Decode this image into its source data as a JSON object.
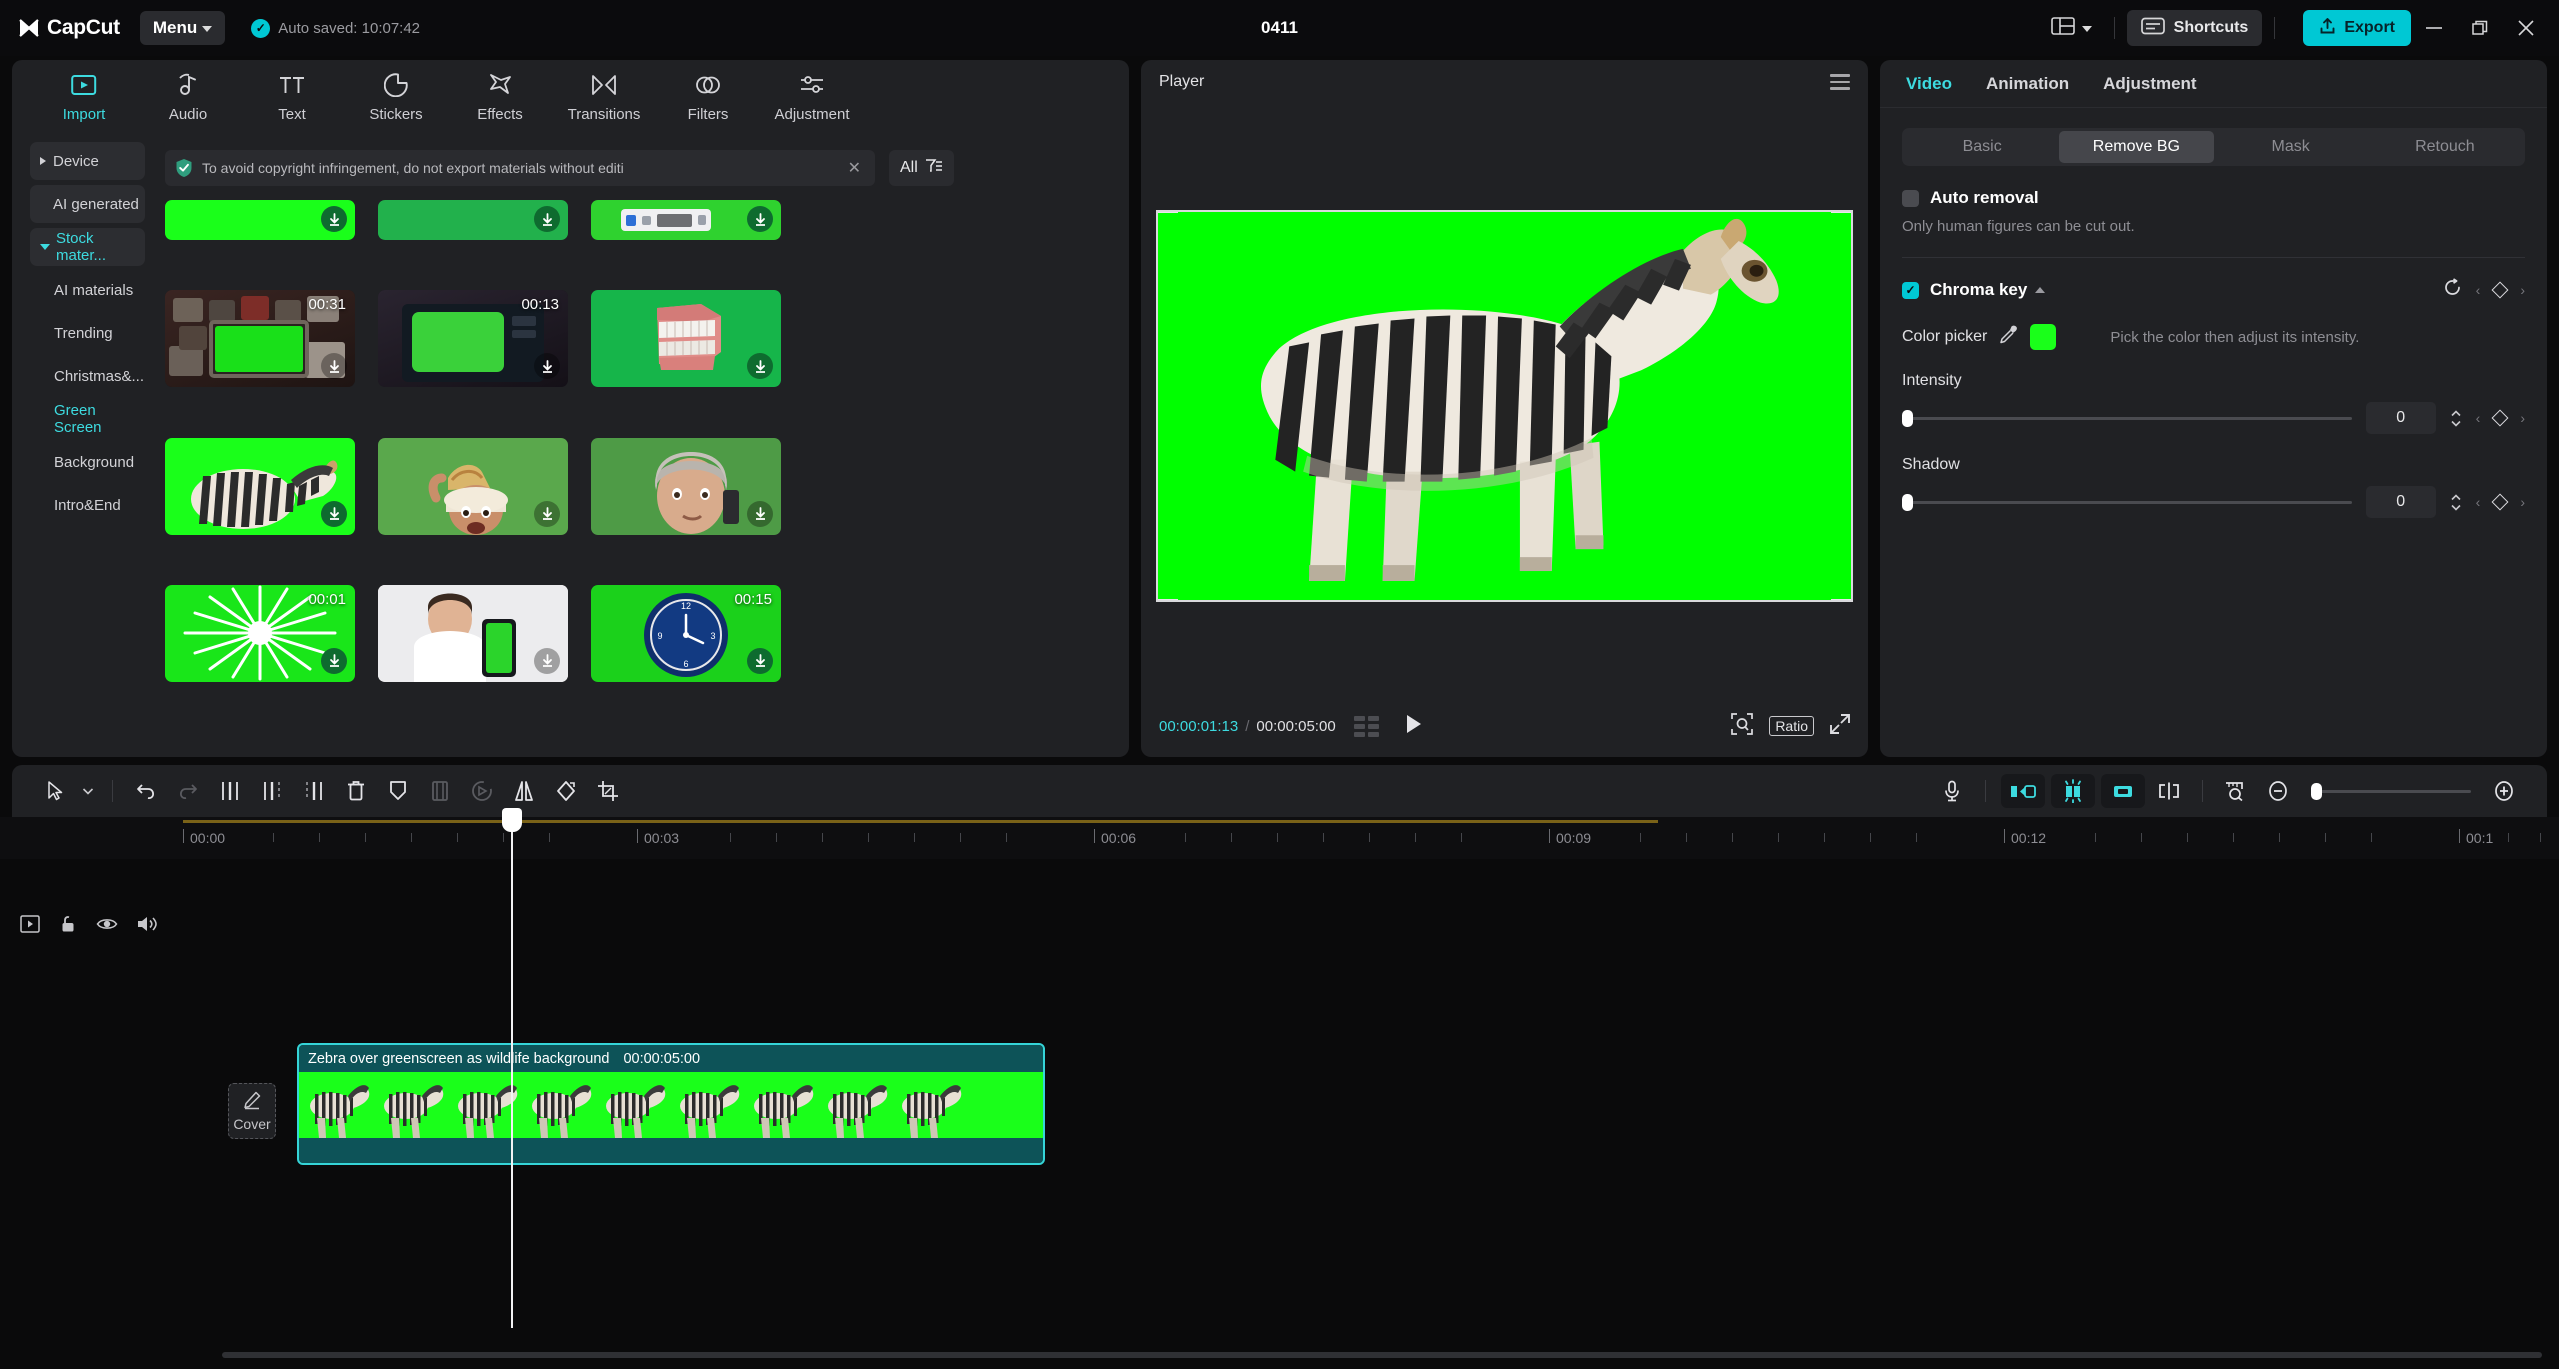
{
  "titlebar": {
    "app_name": "CapCut",
    "menu_label": "Menu",
    "autosave_text": "Auto saved: 10:07:42",
    "project_title": "0411",
    "shortcuts_label": "Shortcuts",
    "export_label": "Export",
    "icons": {
      "layout": "layout-grid-icon",
      "chevron": "chevron-down-icon",
      "minimize": "minimize-icon",
      "restore": "restore-icon",
      "close": "close-icon"
    }
  },
  "left_panel": {
    "nav_tabs": [
      {
        "label": "Import",
        "icon": "import-play-icon",
        "active": true
      },
      {
        "label": "Audio",
        "icon": "audio-note-icon",
        "active": false
      },
      {
        "label": "Text",
        "icon": "text-tt-icon",
        "active": false
      },
      {
        "label": "Stickers",
        "icon": "sticker-icon",
        "active": false
      },
      {
        "label": "Effects",
        "icon": "effects-star-icon",
        "active": false
      },
      {
        "label": "Transitions",
        "icon": "transitions-icon",
        "active": false
      },
      {
        "label": "Filters",
        "icon": "filters-icon",
        "active": false
      },
      {
        "label": "Adjustment",
        "icon": "adjustment-sliders-icon",
        "active": false
      }
    ],
    "sidebar": [
      {
        "label": "Device",
        "type": "boxed",
        "arrow": "right",
        "active": false
      },
      {
        "label": "AI generated",
        "type": "boxed",
        "arrow": "none",
        "active": false
      },
      {
        "label": "Stock mater...",
        "type": "boxed",
        "arrow": "down",
        "active": true
      },
      {
        "label": "AI materials",
        "type": "sub",
        "arrow": "none",
        "active": false
      },
      {
        "label": "Trending",
        "type": "sub",
        "arrow": "none",
        "active": false
      },
      {
        "label": "Christmas&...",
        "type": "sub",
        "arrow": "none",
        "active": false
      },
      {
        "label": "Green Screen",
        "type": "sub",
        "arrow": "none",
        "active": true
      },
      {
        "label": "Background",
        "type": "sub",
        "arrow": "none",
        "active": false
      },
      {
        "label": "Intro&End",
        "type": "sub",
        "arrow": "none",
        "active": false
      }
    ],
    "notice": {
      "text": "To avoid copyright infringement, do not export materials without editi",
      "close_icon": "close-icon",
      "shield_icon": "shield-check-icon"
    },
    "filter": {
      "label": "All",
      "icon": "filter-list-icon"
    },
    "media_items": [
      {
        "name": "green-screen-bar-1",
        "duration": "",
        "variant": "gs"
      },
      {
        "name": "green-screen-bar-2",
        "duration": "",
        "variant": "gs2"
      },
      {
        "name": "green-screen-subscribe",
        "duration": "",
        "variant": "gs3"
      },
      {
        "name": "retro-tv-wall",
        "duration": "00:31",
        "variant": "tv-wall"
      },
      {
        "name": "retro-tv-single",
        "duration": "00:13",
        "variant": "tv-single"
      },
      {
        "name": "chattering-teeth",
        "duration": "",
        "variant": "teeth"
      },
      {
        "name": "zebra-greenscreen",
        "duration": "",
        "variant": "zebra"
      },
      {
        "name": "woman-pizza",
        "duration": "",
        "variant": "pizza"
      },
      {
        "name": "woman-phone",
        "duration": "",
        "variant": "phone"
      },
      {
        "name": "white-burst",
        "duration": "00:01",
        "variant": "burst"
      },
      {
        "name": "doctor-phone",
        "duration": "",
        "variant": "doctor"
      },
      {
        "name": "clock-countdown",
        "duration": "00:15",
        "variant": "clock"
      }
    ]
  },
  "player": {
    "title": "Player",
    "menu_icon": "hamburger-icon",
    "current_time": "00:00:01:13",
    "total_time": "00:00:05:00",
    "separator": "/",
    "play_icon": "play-icon",
    "grid_icon": "grid-icon",
    "magnifier_icon": "magnifier-icon",
    "ratio_label": "Ratio",
    "fullscreen_icon": "fullscreen-icon"
  },
  "right_panel": {
    "tabs": [
      {
        "label": "Video",
        "active": true
      },
      {
        "label": "Animation",
        "active": false
      },
      {
        "label": "Adjustment",
        "active": false
      }
    ],
    "segments": [
      {
        "label": "Basic",
        "active": false
      },
      {
        "label": "Remove BG",
        "active": true
      },
      {
        "label": "Mask",
        "active": false
      },
      {
        "label": "Retouch",
        "active": false
      }
    ],
    "auto_removal": {
      "label": "Auto removal",
      "checked": false,
      "hint": "Only human figures can be cut out."
    },
    "chroma_key": {
      "label": "Chroma key",
      "checked": true,
      "reset_icon": "reset-icon",
      "keyframe_icon": "diamond-keyframe-icon",
      "collapse_icon": "chevron-up-icon"
    },
    "color_picker": {
      "label": "Color picker",
      "eyedropper_icon": "eyedropper-icon",
      "swatch_color": "#1aff1a",
      "hint": "Pick the color then adjust its intensity."
    },
    "sliders": [
      {
        "label": "Intensity",
        "value": "0",
        "percent": 0
      },
      {
        "label": "Shadow",
        "value": "0",
        "percent": 0
      }
    ]
  },
  "timeline": {
    "toolbar_left": [
      {
        "icon": "select-arrow-icon",
        "state": "normal"
      },
      {
        "icon": "chevron-down-icon",
        "state": "normal"
      },
      {
        "icon": "undo-icon",
        "state": "normal"
      },
      {
        "icon": "redo-icon",
        "state": "disabled"
      },
      {
        "icon": "split-icon",
        "state": "normal"
      },
      {
        "icon": "trim-left-icon",
        "state": "normal"
      },
      {
        "icon": "trim-right-icon",
        "state": "normal"
      },
      {
        "icon": "delete-icon",
        "state": "normal"
      },
      {
        "icon": "marker-icon",
        "state": "normal"
      },
      {
        "icon": "freeze-icon",
        "state": "disabled"
      },
      {
        "icon": "reverse-icon",
        "state": "disabled"
      },
      {
        "icon": "mirror-icon",
        "state": "normal"
      },
      {
        "icon": "rotate-icon",
        "state": "normal"
      },
      {
        "icon": "crop-icon",
        "state": "normal"
      }
    ],
    "toolbar_right": [
      {
        "icon": "microphone-icon",
        "state": "normal"
      },
      {
        "icon": "auto-fill-left-icon",
        "state": "cyan"
      },
      {
        "icon": "auto-sync-icon",
        "state": "cyan"
      },
      {
        "icon": "auto-fill-right-icon",
        "state": "cyan"
      },
      {
        "icon": "snap-icon",
        "state": "normal"
      },
      {
        "icon": "zoom-fit-icon",
        "state": "normal"
      },
      {
        "icon": "zoom-out-icon",
        "state": "normal"
      },
      {
        "icon": "zoom-in-icon",
        "state": "normal"
      }
    ],
    "ruler_labels": [
      "00:00",
      "00:03",
      "00:06",
      "00:09",
      "00:12",
      "00:1"
    ],
    "rail_icons": [
      "track-icon",
      "lock-icon",
      "eye-icon",
      "speaker-icon"
    ],
    "cover_label": "Cover",
    "cover_icon": "pencil-icon",
    "clip": {
      "title": "Zebra over greenscreen as wildlife background",
      "duration": "00:00:05:00"
    }
  }
}
